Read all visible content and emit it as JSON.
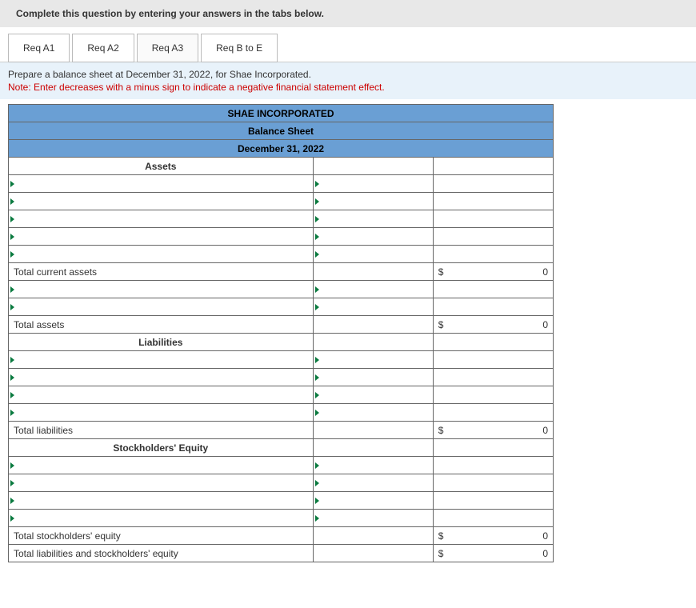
{
  "banner": "Complete this question by entering your answers in the tabs below.",
  "tabs": {
    "a1": "Req A1",
    "a2": "Req A2",
    "a3": "Req A3",
    "be": "Req B to E"
  },
  "prepare": {
    "line1": "Prepare a balance sheet at December 31, 2022, for Shae Incorporated.",
    "note": "Note: Enter decreases with a minus sign to indicate a negative financial statement effect."
  },
  "sheet": {
    "company": "SHAE INCORPORATED",
    "title": "Balance Sheet",
    "date": "December 31, 2022",
    "sections": {
      "assets": "Assets",
      "liabilities": "Liabilities",
      "equity": "Stockholders' Equity"
    },
    "labels": {
      "total_current_assets": "Total current assets",
      "total_assets": "Total assets",
      "total_liabilities": "Total liabilities",
      "total_stockholders_equity": "Total stockholders' equity",
      "total_liab_and_equity": "Total liabilities and stockholders' equity"
    },
    "currency": "$",
    "zero": "0"
  }
}
